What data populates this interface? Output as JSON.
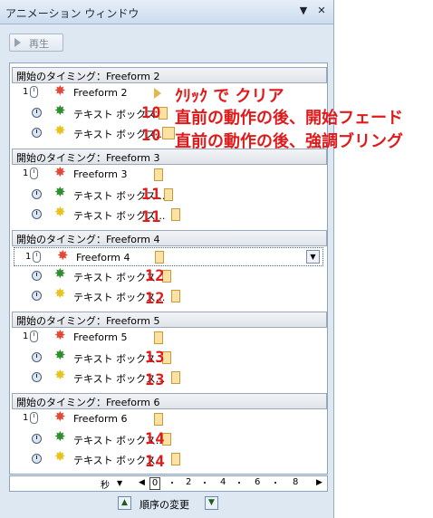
{
  "window": {
    "title": "アニメーション ウィンドウ",
    "dropdown_glyph": "▼",
    "close_glyph": "✕"
  },
  "toolbar": {
    "play_label": "再生"
  },
  "groups": [
    {
      "header": "開始のタイミング：Freeform 2",
      "rows": [
        {
          "num": "1",
          "label": "Freeform 2"
        },
        {
          "label": "テキスト ボックス..."
        },
        {
          "label": "テキスト ボックス..."
        }
      ]
    },
    {
      "header": "開始のタイミング：Freeform 3",
      "rows": [
        {
          "num": "1",
          "label": "Freeform 3"
        },
        {
          "label": "テキスト ボックス..."
        },
        {
          "label": "テキスト ボックス..."
        }
      ]
    },
    {
      "header": "開始のタイミング：Freeform 4",
      "rows": [
        {
          "num": "1",
          "label": "Freeform 4"
        },
        {
          "label": "テキスト ボックス..."
        },
        {
          "label": "テキスト ボックス..."
        }
      ]
    },
    {
      "header": "開始のタイミング：Freeform 5",
      "rows": [
        {
          "num": "1",
          "label": "Freeform 5"
        },
        {
          "label": "テキスト ボックス..."
        },
        {
          "label": "テキスト ボックス..."
        }
      ]
    },
    {
      "header": "開始のタイミング：Freeform 6",
      "rows": [
        {
          "num": "1",
          "label": "Freeform 6"
        },
        {
          "label": "テキスト ボックス..."
        },
        {
          "label": "テキスト ボックス..."
        }
      ]
    }
  ],
  "annotations": {
    "line1": "ｸﾘｯｸ で クリア",
    "line2": "直前の動作の後、開始フェード",
    "line3": "直前の動作の後、強調ブリング",
    "nums": [
      "10",
      "10",
      "11",
      "11",
      "12",
      "12",
      "13",
      "13",
      "14",
      "14"
    ]
  },
  "timeline": {
    "unit": "秒",
    "unit_dropdown": "▼",
    "left_arrow": "◀",
    "right_arrow": "▶",
    "ticks": [
      "0",
      "2",
      "4",
      "6",
      "8"
    ]
  },
  "reorder": {
    "label": "順序の変更",
    "up": "▲",
    "down": "▼"
  },
  "icons": {
    "mouse": "mouse-click-icon",
    "clock": "clock-icon",
    "effect_red": "red-star-icon",
    "effect_green": "green-star-icon",
    "effect_yellow": "yellow-star-icon"
  },
  "colors": {
    "annotation": "#e0191b",
    "pane_bg": "#dde8f3"
  }
}
